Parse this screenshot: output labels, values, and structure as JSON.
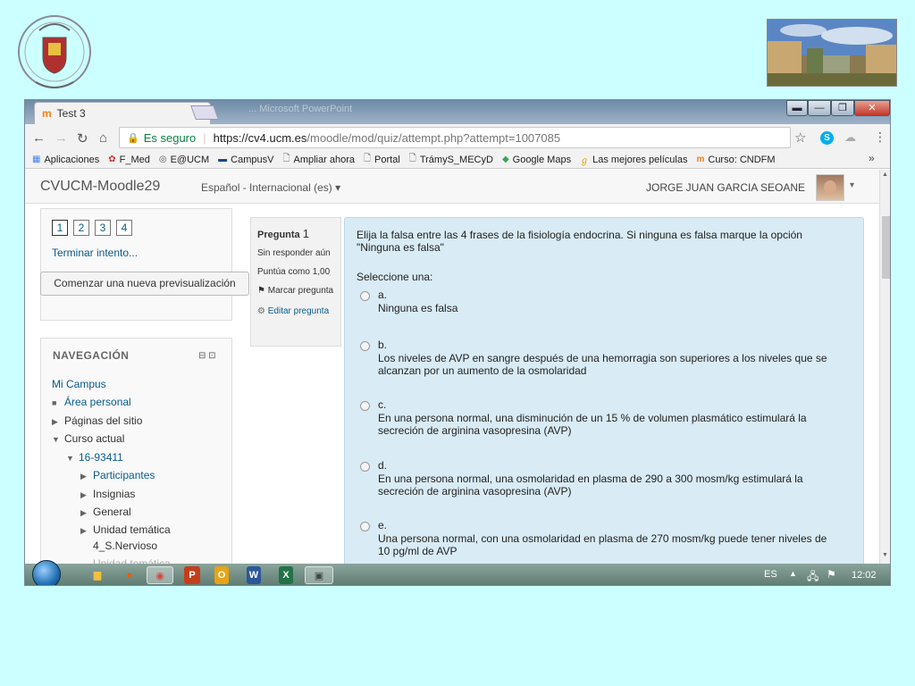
{
  "browser": {
    "tab_title": "Test 3",
    "tab_close": "×",
    "background_window_title": "... Microsoft PowerPoint",
    "url_secure_label": "Es seguro",
    "url_host": "https://cv4.ucm.es",
    "url_path": "/moodle/mod/quiz/attempt.php?attempt=1007085",
    "bookmarks": [
      "Aplicaciones",
      "F_Med",
      "E@UCM",
      "CampusV",
      "Ampliar ahora",
      "Portal",
      "TrámyS_MECyD",
      "Google Maps",
      "Las mejores películas",
      "Curso: CNDFM"
    ],
    "bookmarks_more": "»",
    "skype_letter": "S"
  },
  "moodle": {
    "brand": "CVUCM-Moodle29",
    "language": "Español - Internacional (es) ▾",
    "user_name": "JORGE JUAN GARCIA SEOANE",
    "user_menu": "▾"
  },
  "quiz_nav": {
    "question_buttons": [
      "1",
      "2",
      "3",
      "4"
    ],
    "finish_attempt": "Terminar intento...",
    "new_preview": "Comenzar una nueva previsualización"
  },
  "navigation": {
    "title": "NAVEGACIÓN",
    "items": [
      {
        "label": "Mi Campus",
        "link": true,
        "marker": ""
      },
      {
        "label": "Área personal",
        "link": true,
        "marker": "■"
      },
      {
        "label": "Páginas del sitio",
        "link": false,
        "marker": "▶"
      },
      {
        "label": "Curso actual",
        "link": false,
        "marker": "▼"
      },
      {
        "label": "16-93411",
        "link": true,
        "marker": "▼"
      },
      {
        "label": "Participantes",
        "link": true,
        "marker": "▶"
      },
      {
        "label": "Insignias",
        "link": false,
        "marker": "▶"
      },
      {
        "label": "General",
        "link": false,
        "marker": "▶"
      },
      {
        "label": "Unidad temática",
        "link": false,
        "marker": "▶"
      },
      {
        "label": "4_S.Nervioso",
        "link": false,
        "marker": ""
      },
      {
        "label": "Unidad temática",
        "link": false,
        "marker": ""
      }
    ]
  },
  "question_info": {
    "label": "Pregunta",
    "number": "1",
    "status": "Sin responder aún",
    "score": "Puntúa como 1,00",
    "flag": "Marcar pregunta",
    "edit": "Editar pregunta"
  },
  "question": {
    "text": "Elija la falsa entre las 4 frases de la fisiología endocrina. Si ninguna es falsa marque la opción \"Ninguna es falsa\"",
    "select_prompt": "Seleccione una:",
    "options": [
      {
        "letter": "a.",
        "text": "Ninguna es falsa"
      },
      {
        "letter": "b.",
        "text": "Los niveles de AVP en sangre después de una hemorragia son superiores a los niveles que se alcanzan por un aumento de la osmolaridad"
      },
      {
        "letter": "c.",
        "text": "En una persona normal, una disminución de un 15 % de volumen plasmático estimulará la secreción de arginina vasopresina (AVP)"
      },
      {
        "letter": "d.",
        "text": "En una persona normal, una osmolaridad en plasma de 290 a 300 mosm/kg estimulará la secreción de arginina vasopresina (AVP)"
      },
      {
        "letter": "e.",
        "text": "Una persona normal, con una osmolaridad en plasma de 270 mosm/kg puede tener niveles de 10 pg/ml de AVP"
      }
    ]
  },
  "taskbar": {
    "language": "ES",
    "clock": "12:02",
    "word": "W",
    "excel": "X",
    "outlook": "O",
    "ppt": "P"
  }
}
